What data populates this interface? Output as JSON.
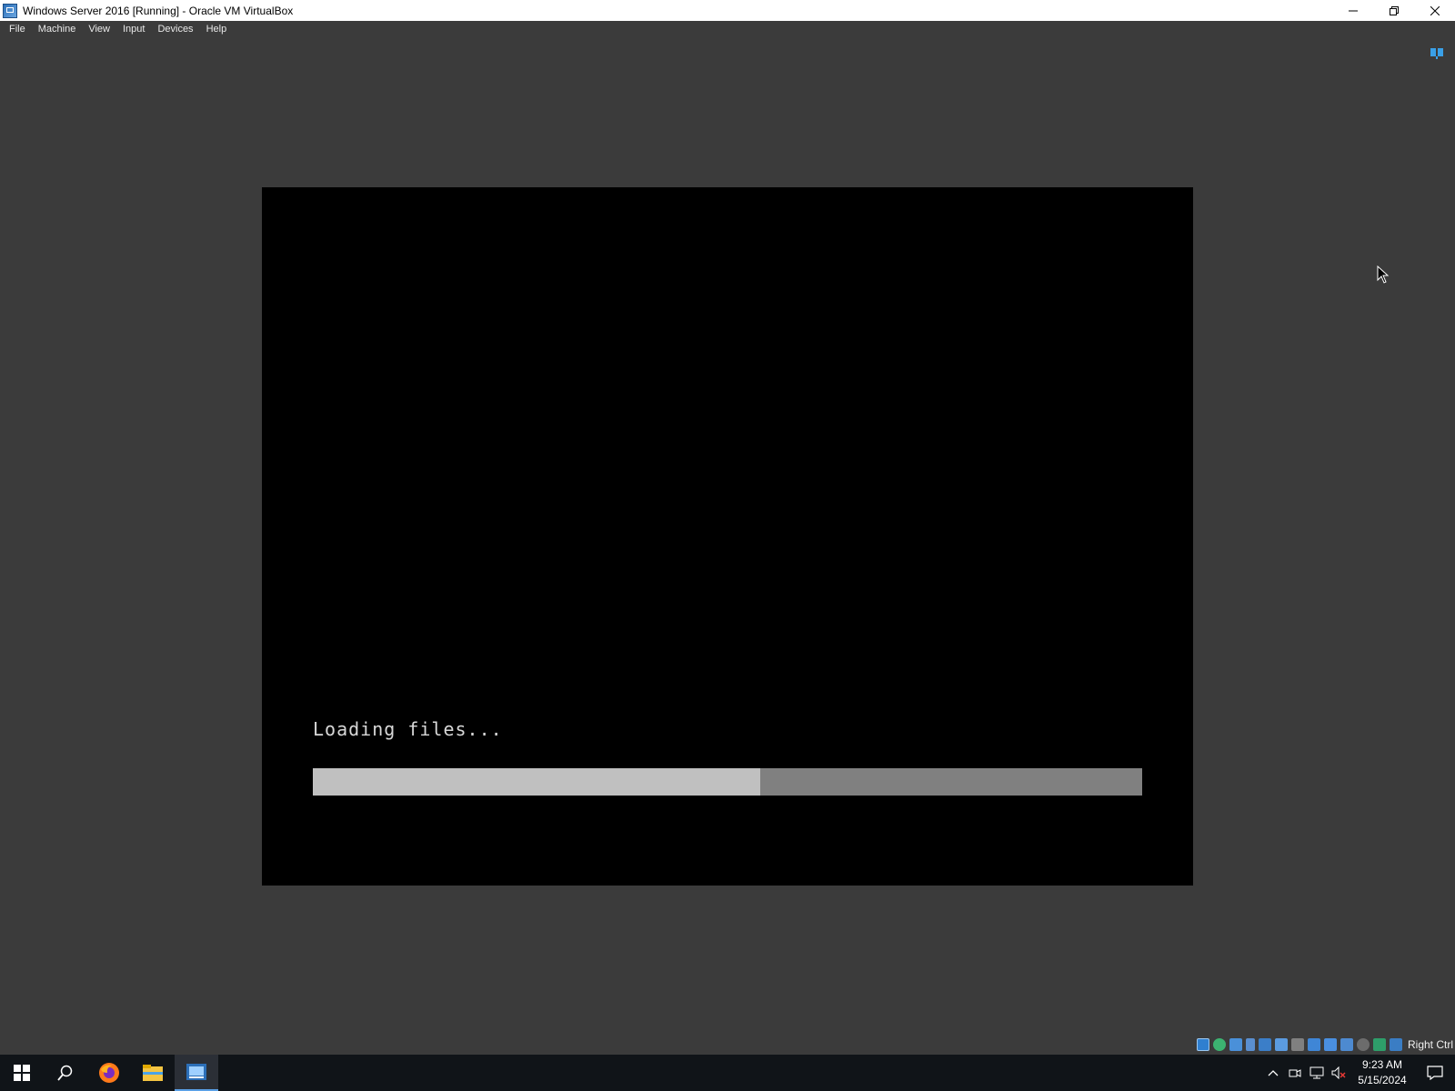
{
  "window": {
    "title": "Windows Server 2016 [Running] - Oracle VM VirtualBox",
    "buttons": [
      "minimize-icon",
      "restore-icon",
      "close-icon"
    ]
  },
  "menubar": {
    "items": [
      "File",
      "Machine",
      "View",
      "Input",
      "Devices",
      "Help"
    ]
  },
  "vm": {
    "loading_text": "Loading files...",
    "progress_fraction": 0.54
  },
  "statusbar": {
    "icons": [
      "hard-disk-icon",
      "optical-drive-icon",
      "floppy-icon",
      "audio-icon",
      "network-icon",
      "usb-icon",
      "shared-folders-icon",
      "display-icon",
      "recording-icon",
      "video-capture-icon",
      "cpu-icon",
      "mouse-integration-icon",
      "keyboard-icon"
    ],
    "host_key": "Right Ctrl"
  },
  "taskbar": {
    "apps": [
      "start-icon",
      "search-icon",
      "firefox-icon",
      "file-explorer-icon",
      "server-2016-icon"
    ],
    "tray": {
      "time": "9:23 AM",
      "date": "5/15/2024"
    }
  },
  "colors": {
    "background": "#3b3b3b",
    "vm_screen": "#000000",
    "progress_fill": "#c0c0c0",
    "progress_track": "#808080",
    "taskbar": "#101418"
  }
}
